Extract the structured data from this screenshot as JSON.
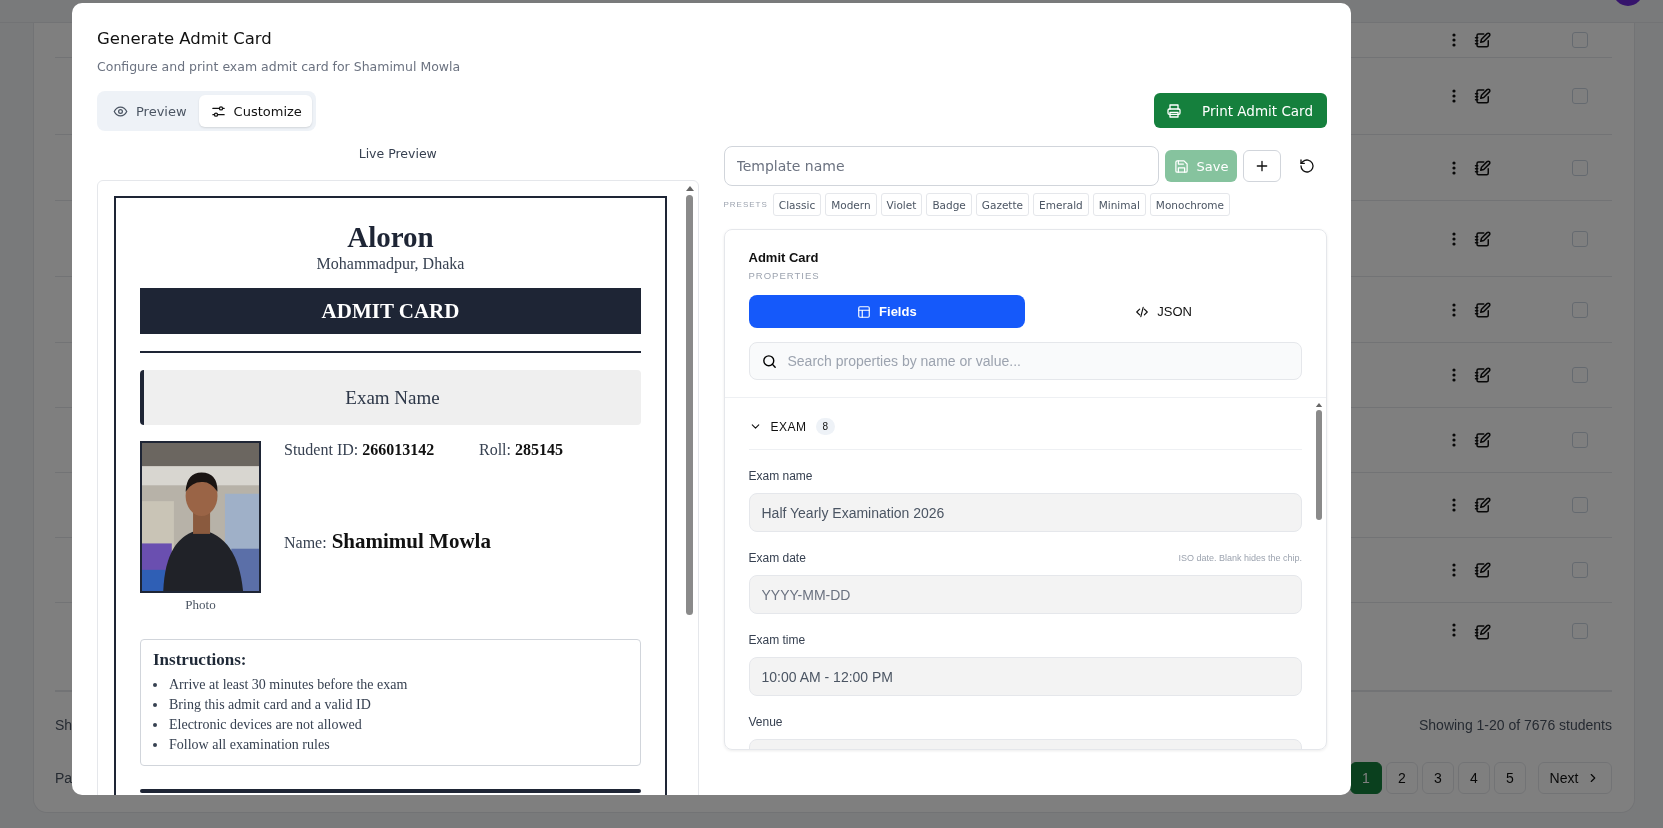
{
  "background": {
    "rows": [
      {
        "checked": false
      },
      {
        "checked": false
      },
      {
        "checked": false
      },
      {
        "checked": false
      },
      {
        "checked": false
      },
      {
        "checked": false
      },
      {
        "checked": false
      },
      {
        "checked": false
      },
      {
        "checked": false
      },
      {
        "checked": false
      }
    ],
    "footer_left": "Sh",
    "summary": "Showing 1-20 of 7676 students",
    "pagination_left": "Pa",
    "pages": [
      {
        "label": "1",
        "selected": true
      },
      {
        "label": "2",
        "selected": false
      },
      {
        "label": "3",
        "selected": false
      },
      {
        "label": "4",
        "selected": false
      },
      {
        "label": "5",
        "selected": false
      }
    ],
    "next": "Next"
  },
  "modal": {
    "title": "Generate Admit Card",
    "subtitle": "Configure and print exam admit card for Shamimul Mowla",
    "view_tabs": [
      {
        "label": "Preview",
        "selected": false
      },
      {
        "label": "Customize",
        "selected": true
      }
    ],
    "print_button": "Print Admit Card",
    "preview": {
      "title": "Live Preview",
      "card": {
        "institution": "Aloron",
        "address": "Mohammadpur, Dhaka",
        "heading": "ADMIT CARD",
        "exam_name": "Exam Name",
        "student_id": "Student ID: **266013142**",
        "roll": "Roll: **285145**",
        "name_label": "Name:",
        "name": "Shamimul Mowla",
        "photo_caption": "Photo",
        "instructions_title": "Instructions:",
        "instructions": [
          "Arrive at least 30 minutes before the exam",
          "Bring this admit card and a valid ID",
          "Electronic devices are not allowed",
          "Follow all examination rules"
        ]
      }
    },
    "editor": {
      "template_placeholder": "Template name",
      "save": {
        "label": "Save",
        "disabled": true
      },
      "presets_label": "PRESETS",
      "presets": [
        "Classic",
        "Modern",
        "Violet",
        "Badge",
        "Gazette",
        "Emerald",
        "Minimal",
        "Monochrome"
      ],
      "properties": {
        "title": "Admit Card",
        "subtitle": "PROPERTIES",
        "tabs": [
          {
            "label": "Fields",
            "selected": true
          },
          {
            "label": "JSON",
            "selected": false
          }
        ],
        "search_placeholder": "Search properties by name or value...",
        "section": {
          "label": "EXAM",
          "count": "8",
          "expanded": true,
          "fields": [
            {
              "label": "Exam name",
              "value": "Half Yearly Examination 2026"
            },
            {
              "label": "Exam date",
              "hint": "ISO date. Blank hides the chip.",
              "placeholder": "YYYY-MM-DD"
            },
            {
              "label": "Exam time",
              "value": "10:00 AM - 12:00 PM"
            },
            {
              "label": "Venue"
            }
          ]
        }
      }
    }
  }
}
